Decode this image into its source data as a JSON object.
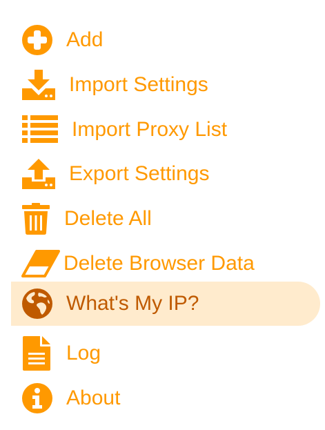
{
  "colors": {
    "accent": "#ff9900",
    "active_bg": "#ffebcd",
    "active_text": "#bf5a00"
  },
  "menu": {
    "items": [
      {
        "label": "Add",
        "icon": "plus-circle-icon",
        "active": false
      },
      {
        "label": "Import Settings",
        "icon": "download-icon",
        "active": false
      },
      {
        "label": "Import Proxy List",
        "icon": "list-icon",
        "active": false
      },
      {
        "label": "Export Settings",
        "icon": "upload-icon",
        "active": false
      },
      {
        "label": "Delete All",
        "icon": "trash-icon",
        "active": false
      },
      {
        "label": "Delete Browser Data",
        "icon": "eraser-icon",
        "active": false
      },
      {
        "label": "What's My IP?",
        "icon": "globe-icon",
        "active": true
      },
      {
        "label": "Log",
        "icon": "document-icon",
        "active": false
      },
      {
        "label": "About",
        "icon": "info-icon",
        "active": false
      }
    ]
  }
}
